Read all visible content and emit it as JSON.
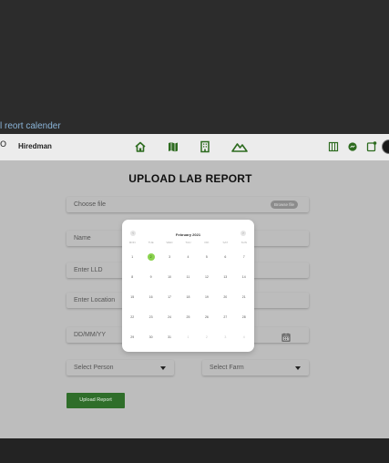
{
  "frame_label": "l reort calender",
  "navbar": {
    "edge_glyph": "O",
    "brand": "Hiredman",
    "icons": [
      "home-icon",
      "map-icon",
      "building-icon",
      "mountain-icon",
      "grid-icon",
      "messenger-icon",
      "notification-icon"
    ]
  },
  "page": {
    "title": "UPLOAD LAB REPORT"
  },
  "form": {
    "choose_file_label": "Choose file",
    "browse_label": "Browse file",
    "name_placeholder": "Name",
    "lld_placeholder": "Enter LLD",
    "location_placeholder": "Enter Location",
    "date_placeholder": "DD/MM/YY",
    "person_select": "Select Person",
    "farm_select": "Select Farm",
    "submit_label": "Upload Report"
  },
  "datepicker": {
    "month": "February 2021",
    "prev": "‹",
    "next": "›",
    "weekdays": [
      "MON",
      "TUE",
      "WED",
      "THU",
      "FRI",
      "SAT",
      "SUN"
    ],
    "selected": "2",
    "weeks": [
      [
        "1",
        "2",
        "3",
        "4",
        "5",
        "6",
        "7"
      ],
      [
        "8",
        "9",
        "10",
        "11",
        "12",
        "13",
        "14"
      ],
      [
        "15",
        "16",
        "17",
        "18",
        "19",
        "20",
        "21"
      ],
      [
        "22",
        "23",
        "24",
        "25",
        "26",
        "27",
        "28"
      ],
      [
        "29",
        "30",
        "31",
        "1",
        "2",
        "3",
        "4"
      ]
    ]
  },
  "colors": {
    "accent": "#2f6e2a",
    "selected_day": "#8bd34f",
    "icon_green": "#2d6b1f"
  }
}
